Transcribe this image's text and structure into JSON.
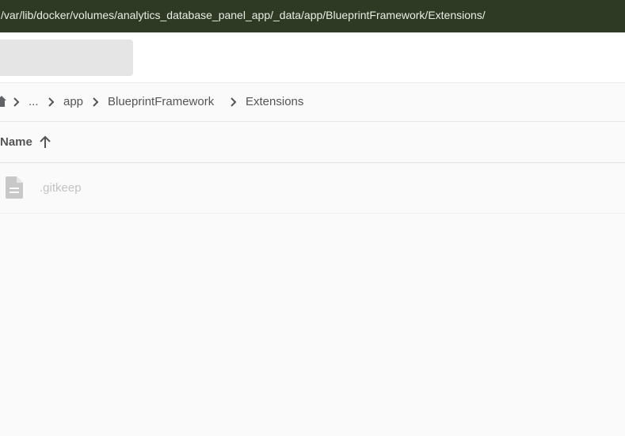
{
  "window": {
    "title_path": "/var/lib/docker/volumes/analytics_database_panel_app/_data/app/BlueprintFramework/Extensions/"
  },
  "toolbar": {
    "search_placeholder": ""
  },
  "breadcrumb": {
    "home_icon": "home-icon",
    "items": [
      "...",
      "app",
      "BlueprintFramework",
      "Extensions"
    ]
  },
  "table": {
    "columns": [
      {
        "label": "Name",
        "sort": "ascending",
        "sort_icon": "arrow-up-icon"
      }
    ],
    "rows": [
      {
        "name": ".gitkeep",
        "icon": "file-document-icon"
      }
    ]
  },
  "colors": {
    "titlebar_bg": "#2f3a25",
    "page_bg": "#fafafa"
  }
}
